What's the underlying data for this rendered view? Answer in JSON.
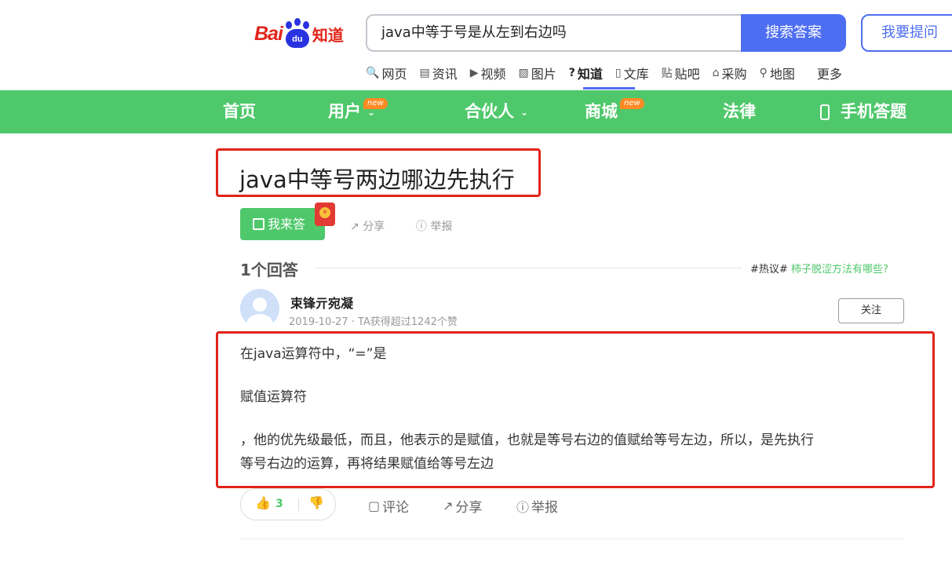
{
  "brand": {
    "bai": "Bai",
    "du": "du",
    "zhidao": "知道"
  },
  "search": {
    "query": "java中等于号是从左到右边吗",
    "button": "搜索答案",
    "ask": "我要提问"
  },
  "nav": {
    "items": [
      {
        "icon": "🔍",
        "label": "网页"
      },
      {
        "icon": "▤",
        "label": "资讯"
      },
      {
        "icon": "▶",
        "label": "视频"
      },
      {
        "icon": "▨",
        "label": "图片"
      },
      {
        "icon": "?",
        "label": "知道"
      },
      {
        "icon": "▯",
        "label": "文库"
      },
      {
        "icon": "贴",
        "label": "贴吧"
      },
      {
        "icon": "⌂",
        "label": "采购"
      },
      {
        "icon": "⚲",
        "label": "地图"
      },
      {
        "icon": "",
        "label": "更多"
      }
    ],
    "active": "知道"
  },
  "green_nav": {
    "home": "首页",
    "user": "用户",
    "partner": "合伙人",
    "mall": "商城",
    "law": "法律",
    "mobile": "手机答题",
    "new_badge": "new"
  },
  "question": {
    "title": "java中等号两边哪边先执行",
    "answer_button": "我来答",
    "share": "分享",
    "report": "举报"
  },
  "answers": {
    "count": "1个回答",
    "hot_tag": "#热议#",
    "hot_link": "柿子脱涩方法有哪些?"
  },
  "answer": {
    "author": "束锋亓宛凝",
    "meta": "2019-10-27 · TA获得超过1242个赞",
    "follow": "关注",
    "p1": "在java运算符中，“=”是",
    "p2": "赋值运算符",
    "p3": "，他的优先级最低，而且，他表示的是赋值，也就是等号右边的值赋给等号左边，所以，是先执行",
    "p4": "等号右边的运算，再将结果赋值给等号左边",
    "likes": "3",
    "comment": "评论",
    "share": "分享",
    "report": "举报"
  },
  "colors": {
    "brand_red": "#e1251b",
    "brand_blue": "#4e6ef2",
    "green": "#4fc86b",
    "highlight_red": "#e2231a"
  }
}
